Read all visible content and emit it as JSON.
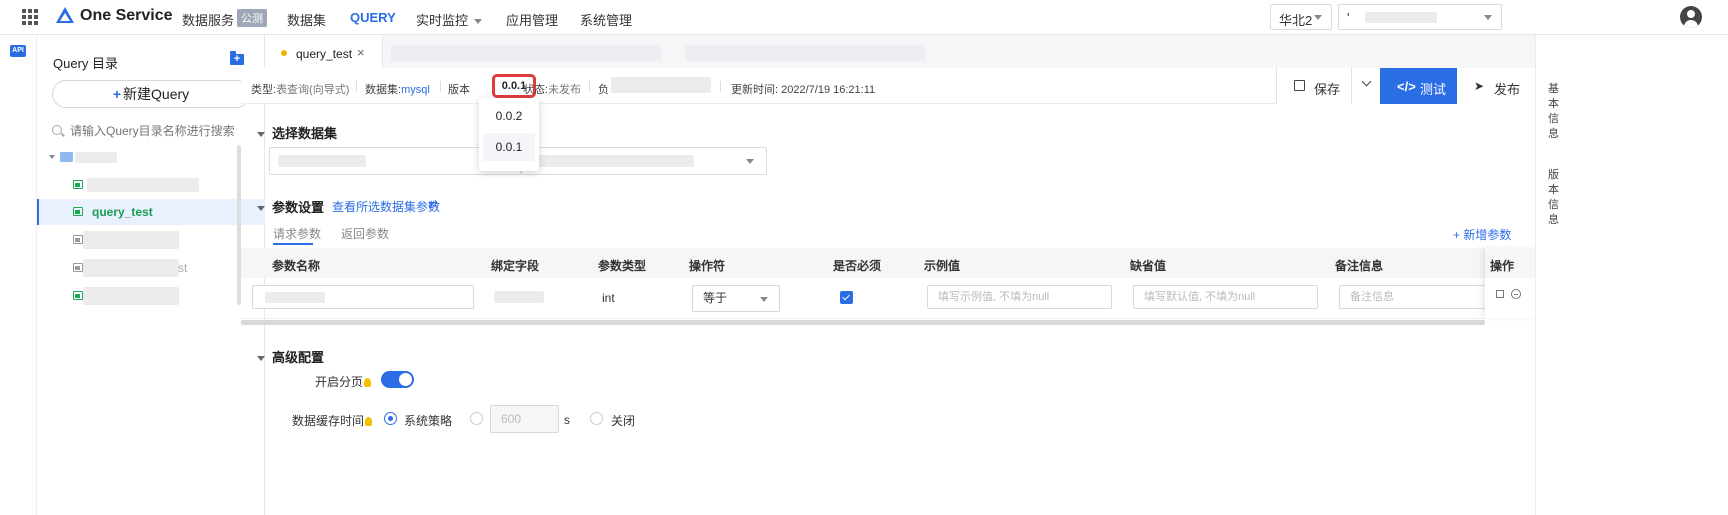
{
  "topbar": {
    "brand": "One Service",
    "subbrand": "数据服务",
    "badge": "公测",
    "nav": [
      "数据集",
      "QUERY",
      "实时监控",
      "应用管理",
      "系统管理"
    ],
    "region": "华北2",
    "account_prefix": "'"
  },
  "sidebar": {
    "title": "Query 目录",
    "new_button": "新建Query",
    "search_placeholder": "请输入Query目录名称进行搜索",
    "active_item": "query_test",
    "partial_text": "st"
  },
  "tabs": [
    {
      "label": "query_test",
      "close": "×"
    }
  ],
  "infobar": {
    "type_label": "类型:",
    "type_value": "表查询(向导式)",
    "dataset_label": "数据集:",
    "dataset_value": "mysql",
    "version_label": "版本",
    "version_value": "0.0.1",
    "status_label": "状态:",
    "status_value": "未发布",
    "owner_label": "负",
    "updated_label": "更新时间:",
    "updated_value": "2022/7/19 16:21:11"
  },
  "toolbar": {
    "save": "保存",
    "test": "测试",
    "publish": "发布"
  },
  "version_dropdown": [
    "0.0.2",
    "0.0.1"
  ],
  "sections": {
    "dataset": "选择数据集",
    "params": "参数设置",
    "params_link": "查看所选数据集参数",
    "advanced": "高级配置"
  },
  "subtabs": [
    "请求参数",
    "返回参数"
  ],
  "add_param": "+ 新增参数",
  "table": {
    "columns": [
      "参数名称",
      "绑定字段",
      "参数类型",
      "操作符",
      "是否必须",
      "示例值",
      "缺省值",
      "备注信息",
      "操作"
    ],
    "row": {
      "name_value": "",
      "type": "int",
      "operator": "等于",
      "required": true,
      "example_placeholder": "填写示例值, 不填为null",
      "default_placeholder": "填写默认值, 不填为null",
      "remark_placeholder": "备注信息"
    }
  },
  "advanced": {
    "paging_label": "开启分页",
    "paging_on": true,
    "cache_label": "数据缓存时间",
    "option_system": "系统策略",
    "cache_value": "600",
    "unit": "s",
    "option_close": "关闭"
  },
  "rightrail": {
    "basic": "基本信息",
    "version": "版本信息"
  },
  "colors": {
    "accent": "#2b6de5",
    "highlight": "#e03c3c",
    "success": "#1a9e50"
  }
}
